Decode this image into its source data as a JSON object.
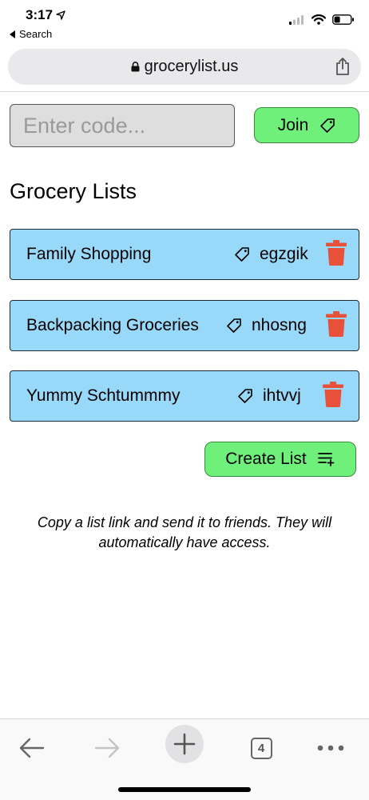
{
  "status_bar": {
    "time": "3:17",
    "back_label": "Search"
  },
  "browser": {
    "url": "grocerylist.us",
    "tab_count": "4"
  },
  "join": {
    "placeholder": "Enter code...",
    "button_label": "Join"
  },
  "section_title": "Grocery Lists",
  "lists": [
    {
      "name": "Family Shopping",
      "code": "egzgik"
    },
    {
      "name": "Backpacking Groceries",
      "code": "nhosng"
    },
    {
      "name": "Yummy Schtummmy",
      "code": "ihtvvj"
    }
  ],
  "create_button_label": "Create List",
  "info_text": "Copy a list link and send it to friends. They will automatically have access.",
  "colors": {
    "list_card": "#98d8f8",
    "button_green": "#6ef07a",
    "trash_red": "#e8503a"
  },
  "icons": {
    "join": "tag-icon",
    "list_code": "tag-icon",
    "delete": "trash-icon",
    "create": "playlist-add-icon"
  }
}
